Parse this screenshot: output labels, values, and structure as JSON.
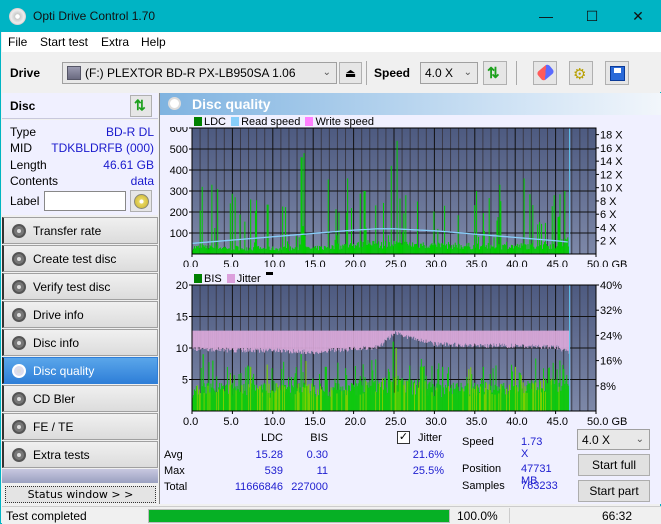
{
  "window": {
    "title": "Opti Drive Control 1.70",
    "minimize_glyph": "—",
    "maximize_glyph": "☐",
    "close_glyph": "✕"
  },
  "menu": [
    "File",
    "Start test",
    "Extra",
    "Help"
  ],
  "toolbar": {
    "drive_label": "Drive",
    "drive_value": "(F:)  PLEXTOR BD-R  PX-LB950SA 1.06",
    "speed_label": "Speed",
    "speed_value": "4.0 X",
    "icons": [
      "eject-icon",
      "refresh-icon",
      "erase-icon",
      "settings-icon",
      "save-icon"
    ]
  },
  "disc": {
    "header": "Disc",
    "type_label": "Type",
    "type_value": "BD-R DL",
    "mid_label": "MID",
    "mid_value": "TDKBLDRFB (000)",
    "length_label": "Length",
    "length_value": "46.61 GB",
    "contents_label": "Contents",
    "contents_value": "data",
    "label_label": "Label",
    "label_value": ""
  },
  "nav": [
    {
      "label": "Transfer rate",
      "active": false
    },
    {
      "label": "Create test disc",
      "active": false
    },
    {
      "label": "Verify test disc",
      "active": false
    },
    {
      "label": "Drive info",
      "active": false
    },
    {
      "label": "Disc info",
      "active": false
    },
    {
      "label": "Disc quality",
      "active": true
    },
    {
      "label": "CD Bler",
      "active": false
    },
    {
      "label": "FE / TE",
      "active": false
    },
    {
      "label": "Extra tests",
      "active": false
    }
  ],
  "status_window_label": "Status window > >",
  "panel": {
    "title": "Disc quality"
  },
  "chart_data": [
    {
      "type": "bar",
      "title": "LDC / Read speed",
      "legend": [
        {
          "name": "LDC",
          "color": "#008000"
        },
        {
          "name": "Read speed",
          "color": "#87cefa"
        },
        {
          "name": "Write speed",
          "color": "#ff80ff"
        }
      ],
      "legend_position": "top-left",
      "xlabel": "GB",
      "x_ticks": [
        "0.0",
        "5.0",
        "10.0",
        "15.0",
        "20.0",
        "25.0",
        "30.0",
        "35.0",
        "40.0",
        "45.0",
        "50.0 GB"
      ],
      "xlim": [
        0,
        50
      ],
      "y_ticks": [
        "100",
        "200",
        "300",
        "400",
        "500",
        "600"
      ],
      "ylim": [
        0,
        600
      ],
      "y2_ticks": [
        "2 X",
        "4 X",
        "6 X",
        "8 X",
        "10 X",
        "12 X",
        "14 X",
        "16 X",
        "18 X"
      ],
      "y2lim": [
        0,
        19
      ],
      "data_end_gb": 46.61,
      "series": [
        {
          "name": "LDC baseline (approx)",
          "x": [
            0,
            5,
            10,
            15,
            20,
            25,
            30,
            35,
            40,
            45,
            46.6
          ],
          "values": [
            30,
            28,
            25,
            25,
            40,
            45,
            40,
            35,
            35,
            40,
            60
          ]
        },
        {
          "name": "LDC peaks (approx)",
          "x": [
            1.2,
            2.4,
            3.1,
            5.3,
            7.2,
            9.3,
            13.5,
            13.8,
            16.8,
            19.2,
            21.3,
            24.6,
            25.3,
            26.4,
            27.8,
            35.2,
            38.0,
            41.0,
            44.8,
            46.1
          ],
          "values": [
            320,
            330,
            310,
            270,
            260,
            235,
            460,
            480,
            355,
            360,
            300,
            420,
            539,
            280,
            250,
            300,
            330,
            360,
            280,
            300
          ]
        },
        {
          "name": "Read speed",
          "x": [
            0,
            5,
            10,
            15,
            20,
            23,
            25,
            30,
            35,
            40,
            45,
            46.6
          ],
          "values": [
            1.6,
            2.1,
            2.6,
            3.1,
            3.6,
            3.8,
            3.8,
            3.5,
            3.0,
            2.5,
            2.0,
            1.8
          ]
        }
      ]
    },
    {
      "type": "bar",
      "title": "BIS / Jitter",
      "legend": [
        {
          "name": "BIS",
          "color": "#008000"
        },
        {
          "name": "Jitter",
          "color": "#dca0dc"
        }
      ],
      "legend_position": "top-left",
      "xlabel": "GB",
      "x_ticks": [
        "0.0",
        "5.0",
        "10.0",
        "15.0",
        "20.0",
        "25.0",
        "30.0",
        "35.0",
        "40.0",
        "45.0",
        "50.0 GB"
      ],
      "xlim": [
        0,
        50
      ],
      "y_ticks": [
        "5",
        "10",
        "15",
        "20"
      ],
      "ylim": [
        0,
        20
      ],
      "y2_ticks": [
        "8%",
        "16%",
        "24%",
        "32%",
        "40%"
      ],
      "y2lim": [
        0,
        40
      ],
      "data_end_gb": 46.61,
      "series": [
        {
          "name": "BIS typical (approx)",
          "x": [
            0,
            10,
            20,
            25,
            30,
            40,
            46.6
          ],
          "values": [
            3,
            3,
            3,
            4,
            3,
            3,
            4
          ]
        },
        {
          "name": "BIS peaks (approx)",
          "x": [
            1.3,
            2.5,
            7.2,
            13.4,
            16.5,
            24.8,
            25.2,
            28.5,
            31.0,
            36.0,
            40.0,
            45.5
          ],
          "values": [
            9,
            8,
            7,
            9,
            7,
            11,
            10,
            7,
            7,
            7,
            7,
            8
          ]
        },
        {
          "name": "Jitter (%)",
          "x": [
            0,
            5,
            10,
            15,
            20,
            23,
            25,
            30,
            35,
            40,
            45,
            46.6
          ],
          "values": [
            20.5,
            20.0,
            20.0,
            19.5,
            20.5,
            21.0,
            25.5,
            22.0,
            21.5,
            21.5,
            21.0,
            19.5
          ]
        }
      ]
    }
  ],
  "stats": {
    "col_ldc": "LDC",
    "col_bis": "BIS",
    "jitter_label": "Jitter",
    "jitter_checked": true,
    "avg_label": "Avg",
    "avg_ldc": "15.28",
    "avg_bis": "0.30",
    "avg_jitter": "21.6%",
    "max_label": "Max",
    "max_ldc": "539",
    "max_bis": "11",
    "max_jitter": "25.5%",
    "total_label": "Total",
    "total_ldc": "11666846",
    "total_bis": "227000",
    "speed_label": "Speed",
    "speed_value": "1.73 X",
    "position_label": "Position",
    "position_value": "47731 MB",
    "samples_label": "Samples",
    "samples_value": "763233",
    "speed_select": "4.0 X",
    "start_full": "Start full",
    "start_part": "Start part"
  },
  "statusbar": {
    "text": "Test completed",
    "progress_percent": 100,
    "progress_text": "100.0%",
    "elapsed": "66:32"
  }
}
